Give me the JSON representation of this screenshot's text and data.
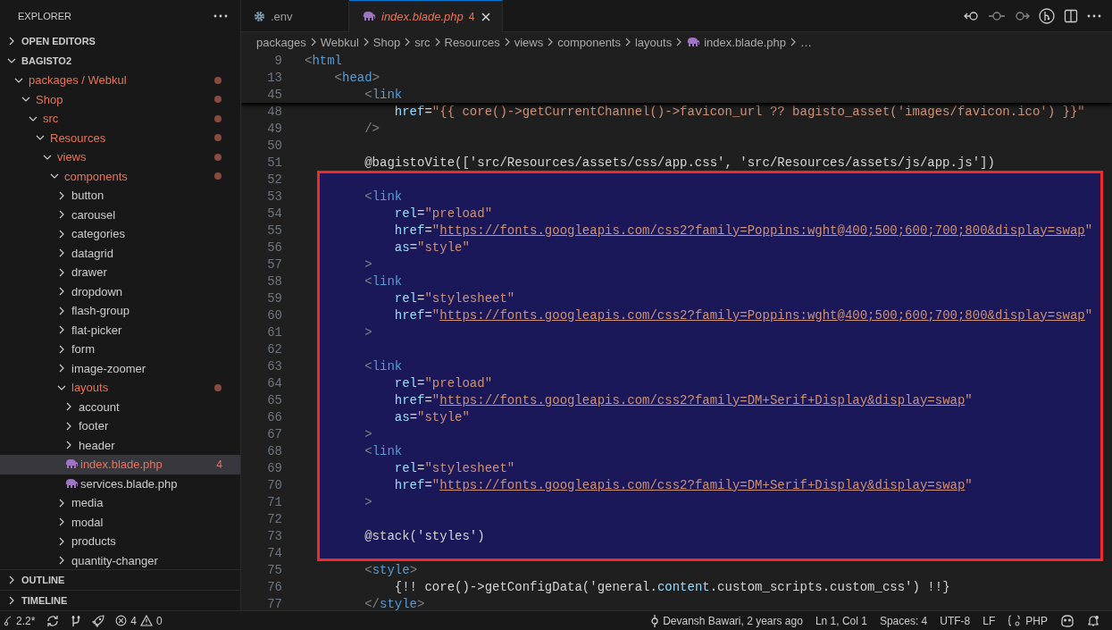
{
  "sidebar": {
    "title": "EXPLORER",
    "sections": [
      {
        "label": "OPEN EDITORS",
        "expanded": false
      },
      {
        "label": "BAGISTO2",
        "expanded": true
      }
    ],
    "tree": [
      {
        "label": "packages / Webkul",
        "kind": "folder",
        "expanded": true,
        "modified": true,
        "selected": false,
        "children": [
          {
            "label": "Shop",
            "kind": "folder",
            "expanded": true,
            "modified": true,
            "selected": false,
            "children": [
              {
                "label": "src",
                "kind": "folder",
                "expanded": true,
                "modified": true,
                "selected": false,
                "children": [
                  {
                    "label": "Resources",
                    "kind": "folder",
                    "expanded": true,
                    "modified": true,
                    "selected": false,
                    "children": [
                      {
                        "label": "views",
                        "kind": "folder",
                        "expanded": true,
                        "modified": true,
                        "selected": false,
                        "children": [
                          {
                            "label": "components",
                            "kind": "folder",
                            "expanded": true,
                            "modified": true,
                            "selected": false,
                            "children": [
                              {
                                "label": "button",
                                "kind": "folder",
                                "expanded": false,
                                "modified": false,
                                "selected": false
                              },
                              {
                                "label": "carousel",
                                "kind": "folder",
                                "expanded": false,
                                "modified": false,
                                "selected": false
                              },
                              {
                                "label": "categories",
                                "kind": "folder",
                                "expanded": false,
                                "modified": false,
                                "selected": false
                              },
                              {
                                "label": "datagrid",
                                "kind": "folder",
                                "expanded": false,
                                "modified": false,
                                "selected": false
                              },
                              {
                                "label": "drawer",
                                "kind": "folder",
                                "expanded": false,
                                "modified": false,
                                "selected": false
                              },
                              {
                                "label": "dropdown",
                                "kind": "folder",
                                "expanded": false,
                                "modified": false,
                                "selected": false
                              },
                              {
                                "label": "flash-group",
                                "kind": "folder",
                                "expanded": false,
                                "modified": false,
                                "selected": false
                              },
                              {
                                "label": "flat-picker",
                                "kind": "folder",
                                "expanded": false,
                                "modified": false,
                                "selected": false
                              },
                              {
                                "label": "form",
                                "kind": "folder",
                                "expanded": false,
                                "modified": false,
                                "selected": false
                              },
                              {
                                "label": "image-zoomer",
                                "kind": "folder",
                                "expanded": false,
                                "modified": false,
                                "selected": false
                              },
                              {
                                "label": "layouts",
                                "kind": "folder",
                                "expanded": true,
                                "modified": true,
                                "selected": false,
                                "children": [
                                  {
                                    "label": "account",
                                    "kind": "folder",
                                    "expanded": false,
                                    "modified": false,
                                    "selected": false
                                  },
                                  {
                                    "label": "footer",
                                    "kind": "folder",
                                    "expanded": false,
                                    "modified": false,
                                    "selected": false
                                  },
                                  {
                                    "label": "header",
                                    "kind": "folder",
                                    "expanded": false,
                                    "modified": false,
                                    "selected": false
                                  },
                                  {
                                    "label": "index.blade.php",
                                    "kind": "file",
                                    "modified": true,
                                    "selected": true,
                                    "badge": "4"
                                  },
                                  {
                                    "label": "services.blade.php",
                                    "kind": "file",
                                    "modified": false,
                                    "selected": false
                                  }
                                ]
                              },
                              {
                                "label": "media",
                                "kind": "folder",
                                "expanded": false,
                                "modified": false,
                                "selected": false
                              },
                              {
                                "label": "modal",
                                "kind": "folder",
                                "expanded": false,
                                "modified": false,
                                "selected": false
                              },
                              {
                                "label": "products",
                                "kind": "folder",
                                "expanded": false,
                                "modified": false,
                                "selected": false
                              },
                              {
                                "label": "quantity-changer",
                                "kind": "folder",
                                "expanded": false,
                                "modified": false,
                                "selected": false
                              }
                            ]
                          }
                        ]
                      }
                    ]
                  }
                ]
              }
            ]
          }
        ]
      }
    ],
    "bottom_sections": [
      {
        "label": "OUTLINE",
        "expanded": false
      },
      {
        "label": "TIMELINE",
        "expanded": false
      }
    ]
  },
  "tabs": [
    {
      "label": ".env",
      "kind": "settings",
      "selected": false,
      "modified": false,
      "preview": false
    },
    {
      "label": "index.blade.php",
      "kind": "php",
      "selected": true,
      "modified": true,
      "preview": true,
      "badge": "4"
    }
  ],
  "editor_actions": [
    {
      "kind": "back"
    },
    {
      "kind": "circle"
    },
    {
      "kind": "forward"
    },
    {
      "kind": "graph"
    },
    {
      "kind": "split"
    },
    {
      "kind": "more"
    }
  ],
  "breadcrumbs": [
    {
      "label": "packages",
      "kind": "folder"
    },
    {
      "label": "Webkul",
      "kind": "folder"
    },
    {
      "label": "Shop",
      "kind": "folder"
    },
    {
      "label": "src",
      "kind": "folder"
    },
    {
      "label": "Resources",
      "kind": "folder"
    },
    {
      "label": "views",
      "kind": "folder"
    },
    {
      "label": "components",
      "kind": "folder"
    },
    {
      "label": "layouts",
      "kind": "folder"
    },
    {
      "label": "index.blade.php",
      "kind": "file"
    },
    {
      "label": "…",
      "kind": "more"
    }
  ],
  "editor": {
    "sticky_lines": [
      {
        "number": "9",
        "tokens": [
          {
            "kind": "punct",
            "text": "<"
          },
          {
            "kind": "tag",
            "text": "html"
          }
        ]
      },
      {
        "number": "13",
        "tokens": [
          {
            "kind": "punct",
            "text": "    <"
          },
          {
            "kind": "tag",
            "text": "head"
          },
          {
            "kind": "punct",
            "text": ">"
          }
        ]
      },
      {
        "number": "45",
        "tokens": [
          {
            "kind": "punct",
            "text": "        <"
          },
          {
            "kind": "tag",
            "text": "link"
          }
        ]
      }
    ],
    "lines": [
      {
        "number": "48",
        "selected": false,
        "tokens": [
          {
            "kind": "attr",
            "text": "            href"
          },
          {
            "kind": "plain",
            "text": "="
          },
          {
            "kind": "string",
            "text": "\"{{ core()->getCurrentChannel()->favicon_url ?? bagisto_asset('images/favicon.ico') }}\""
          }
        ]
      },
      {
        "number": "49",
        "selected": false,
        "tokens": [
          {
            "kind": "punct",
            "text": "        />"
          }
        ]
      },
      {
        "number": "50",
        "selected": false
      },
      {
        "number": "51",
        "selected": false,
        "tokens": [
          {
            "kind": "plain",
            "text": "        @bagistoVite(['src/Resources/assets/css/app.css', 'src/Resources/assets/js/app.js'])"
          }
        ]
      },
      {
        "number": "52",
        "selected": true
      },
      {
        "number": "53",
        "selected": true,
        "tokens": [
          {
            "kind": "punct",
            "text": "        <"
          },
          {
            "kind": "tag",
            "text": "link"
          }
        ]
      },
      {
        "number": "54",
        "selected": true,
        "tokens": [
          {
            "kind": "attr",
            "text": "            rel"
          },
          {
            "kind": "plain",
            "text": "="
          },
          {
            "kind": "string",
            "text": "\"preload\""
          }
        ]
      },
      {
        "number": "55",
        "selected": true,
        "tokens": [
          {
            "kind": "attr",
            "text": "            href"
          },
          {
            "kind": "plain",
            "text": "="
          },
          {
            "kind": "string",
            "text": "\""
          },
          {
            "kind": "url",
            "text": "https://fonts.googleapis.com/css2?family=Poppins:wght@400;500;600;700;800&display=swap"
          },
          {
            "kind": "string",
            "text": "\""
          }
        ]
      },
      {
        "number": "56",
        "selected": true,
        "tokens": [
          {
            "kind": "attr",
            "text": "            as"
          },
          {
            "kind": "plain",
            "text": "="
          },
          {
            "kind": "string",
            "text": "\"style\""
          }
        ]
      },
      {
        "number": "57",
        "selected": true,
        "tokens": [
          {
            "kind": "punct",
            "text": "        >"
          }
        ]
      },
      {
        "number": "58",
        "selected": true,
        "tokens": [
          {
            "kind": "punct",
            "text": "        <"
          },
          {
            "kind": "tag",
            "text": "link"
          }
        ]
      },
      {
        "number": "59",
        "selected": true,
        "tokens": [
          {
            "kind": "attr",
            "text": "            rel"
          },
          {
            "kind": "plain",
            "text": "="
          },
          {
            "kind": "string",
            "text": "\"stylesheet\""
          }
        ]
      },
      {
        "number": "60",
        "selected": true,
        "tokens": [
          {
            "kind": "attr",
            "text": "            href"
          },
          {
            "kind": "plain",
            "text": "="
          },
          {
            "kind": "string",
            "text": "\""
          },
          {
            "kind": "url",
            "text": "https://fonts.googleapis.com/css2?family=Poppins:wght@400;500;600;700;800&display=swap"
          },
          {
            "kind": "string",
            "text": "\""
          }
        ]
      },
      {
        "number": "61",
        "selected": true,
        "tokens": [
          {
            "kind": "punct",
            "text": "        >"
          }
        ]
      },
      {
        "number": "62",
        "selected": true
      },
      {
        "number": "63",
        "selected": true,
        "tokens": [
          {
            "kind": "punct",
            "text": "        <"
          },
          {
            "kind": "tag",
            "text": "link"
          }
        ]
      },
      {
        "number": "64",
        "selected": true,
        "tokens": [
          {
            "kind": "attr",
            "text": "            rel"
          },
          {
            "kind": "plain",
            "text": "="
          },
          {
            "kind": "string",
            "text": "\"preload\""
          }
        ]
      },
      {
        "number": "65",
        "selected": true,
        "tokens": [
          {
            "kind": "attr",
            "text": "            href"
          },
          {
            "kind": "plain",
            "text": "="
          },
          {
            "kind": "string",
            "text": "\""
          },
          {
            "kind": "url",
            "text": "https://fonts.googleapis.com/css2?family=DM+Serif+Display&display=swap"
          },
          {
            "kind": "string",
            "text": "\""
          }
        ]
      },
      {
        "number": "66",
        "selected": true,
        "tokens": [
          {
            "kind": "attr",
            "text": "            as"
          },
          {
            "kind": "plain",
            "text": "="
          },
          {
            "kind": "string",
            "text": "\"style\""
          }
        ]
      },
      {
        "number": "67",
        "selected": true,
        "tokens": [
          {
            "kind": "punct",
            "text": "        >"
          }
        ]
      },
      {
        "number": "68",
        "selected": true,
        "tokens": [
          {
            "kind": "punct",
            "text": "        <"
          },
          {
            "kind": "tag",
            "text": "link"
          }
        ]
      },
      {
        "number": "69",
        "selected": true,
        "tokens": [
          {
            "kind": "attr",
            "text": "            rel"
          },
          {
            "kind": "plain",
            "text": "="
          },
          {
            "kind": "string",
            "text": "\"stylesheet\""
          }
        ]
      },
      {
        "number": "70",
        "selected": true,
        "tokens": [
          {
            "kind": "attr",
            "text": "            href"
          },
          {
            "kind": "plain",
            "text": "="
          },
          {
            "kind": "string",
            "text": "\""
          },
          {
            "kind": "url",
            "text": "https://fonts.googleapis.com/css2?family=DM+Serif+Display&display=swap"
          },
          {
            "kind": "string",
            "text": "\""
          }
        ]
      },
      {
        "number": "71",
        "selected": true,
        "tokens": [
          {
            "kind": "punct",
            "text": "        >"
          }
        ]
      },
      {
        "number": "72",
        "selected": true
      },
      {
        "number": "73",
        "selected": true,
        "tokens": [
          {
            "kind": "plain",
            "text": "        @stack('styles')"
          }
        ]
      },
      {
        "number": "74",
        "selected": true
      },
      {
        "number": "75",
        "selected": false,
        "tokens": [
          {
            "kind": "punct",
            "text": "        <"
          },
          {
            "kind": "tag",
            "text": "style"
          },
          {
            "kind": "punct",
            "text": ">"
          }
        ]
      },
      {
        "number": "76",
        "selected": false,
        "tokens": [
          {
            "kind": "plain",
            "text": "            {!! core()->getConfigData('general."
          },
          {
            "kind": "attr",
            "text": "content"
          },
          {
            "kind": "plain",
            "text": ".custom_scripts.custom_css') !!}"
          }
        ]
      },
      {
        "number": "77",
        "selected": false,
        "tokens": [
          {
            "kind": "punct",
            "text": "        </"
          },
          {
            "kind": "tag",
            "text": "style"
          },
          {
            "kind": "punct",
            "text": ">"
          }
        ]
      }
    ]
  },
  "status_bar": {
    "left": [
      {
        "kind": "branch",
        "text": "2.2*"
      },
      {
        "kind": "sync"
      },
      {
        "kind": "ports"
      },
      {
        "kind": "rocket"
      },
      {
        "kind": "problems",
        "errors": "4",
        "warnings": "0"
      }
    ],
    "right": [
      {
        "kind": "blame",
        "text": "Devansh Bawari, 2 years ago"
      },
      {
        "kind": "text",
        "text": "Ln 1, Col 1"
      },
      {
        "kind": "text",
        "text": "Spaces: 4"
      },
      {
        "kind": "text",
        "text": "UTF-8"
      },
      {
        "kind": "text",
        "text": "LF"
      },
      {
        "kind": "language",
        "text": "PHP"
      },
      {
        "kind": "copilot"
      },
      {
        "kind": "bell"
      }
    ]
  }
}
